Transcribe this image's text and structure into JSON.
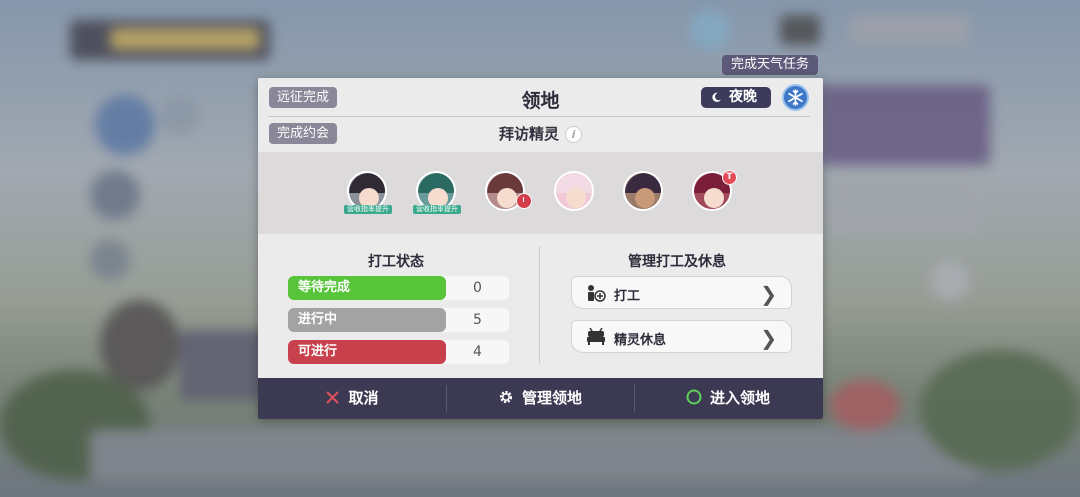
{
  "colors": {
    "accent_dark": "#3c3a52",
    "pending_green": "#58c43a",
    "in_progress_gray": "#a3a3a3",
    "available_red": "#c7404c",
    "snow_blue": "#3f78c8"
  },
  "weather_tag": "完成天气任务",
  "header": {
    "left_pill_1": "远征完成",
    "left_pill_2": "完成约会",
    "title": "领地",
    "time_of_day": "夜晚",
    "time_icon": "moon-icon",
    "weather_icon": "snowflake-icon",
    "subtitle": "拜访精灵",
    "info_glyph": "i"
  },
  "avatars": [
    {
      "badge": "营收指率提升",
      "status": "none"
    },
    {
      "badge": "营收指率提升",
      "status": "none"
    },
    {
      "badge": "",
      "status": "clock"
    },
    {
      "badge": "",
      "status": "none"
    },
    {
      "badge": "",
      "status": "none"
    },
    {
      "badge": "",
      "status": "T"
    }
  ],
  "work_status": {
    "title": "打工状态",
    "rows": [
      {
        "label": "等待完成",
        "value": "0"
      },
      {
        "label": "进行中",
        "value": "5"
      },
      {
        "label": "可进行",
        "value": "4"
      }
    ]
  },
  "manage": {
    "title": "管理打工及休息",
    "buttons": [
      {
        "label": "打工",
        "icon": "worker-add-icon"
      },
      {
        "label": "精灵休息",
        "icon": "bed-icon"
      }
    ]
  },
  "footer": {
    "cancel": "取消",
    "manage": "管理领地",
    "enter": "进入领地"
  }
}
